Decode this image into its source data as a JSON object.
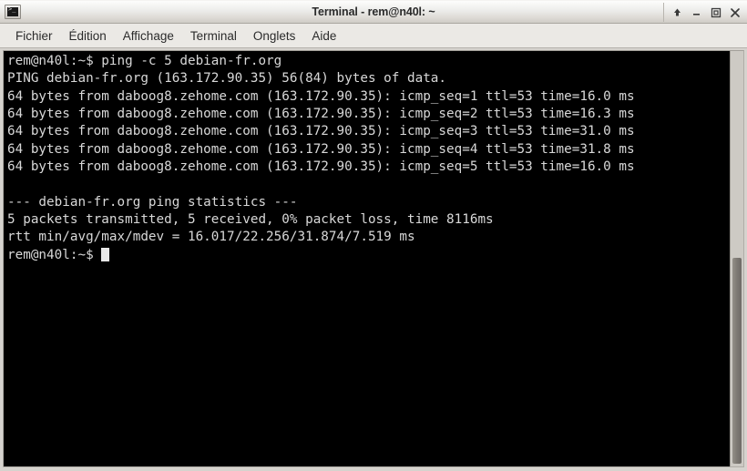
{
  "window": {
    "title": "Terminal - rem@n40l: ~",
    "icon": "terminal-icon",
    "controls": [
      {
        "name": "shade-button",
        "glyph": "↑"
      },
      {
        "name": "minimize-button",
        "glyph": "–"
      },
      {
        "name": "maximize-button",
        "glyph": "□"
      },
      {
        "name": "close-button",
        "glyph": "✕"
      }
    ]
  },
  "menubar": {
    "items": [
      {
        "label": "Fichier"
      },
      {
        "label": "Édition"
      },
      {
        "label": "Affichage"
      },
      {
        "label": "Terminal"
      },
      {
        "label": "Onglets"
      },
      {
        "label": "Aide"
      }
    ]
  },
  "terminal": {
    "background": "#000000",
    "foreground": "#d8d8d8",
    "prompt": "rem@n40l:~$ ",
    "command": "ping -c 5 debian-fr.org",
    "lines": [
      "rem@n40l:~$ ping -c 5 debian-fr.org",
      "PING debian-fr.org (163.172.90.35) 56(84) bytes of data.",
      "64 bytes from daboog8.zehome.com (163.172.90.35): icmp_seq=1 ttl=53 time=16.0 ms",
      "64 bytes from daboog8.zehome.com (163.172.90.35): icmp_seq=2 ttl=53 time=16.3 ms",
      "64 bytes from daboog8.zehome.com (163.172.90.35): icmp_seq=3 ttl=53 time=31.0 ms",
      "64 bytes from daboog8.zehome.com (163.172.90.35): icmp_seq=4 ttl=53 time=31.8 ms",
      "64 bytes from daboog8.zehome.com (163.172.90.35): icmp_seq=5 ttl=53 time=16.0 ms",
      "",
      "--- debian-fr.org ping statistics ---",
      "5 packets transmitted, 5 received, 0% packet loss, time 8116ms",
      "rtt min/avg/max/mdev = 16.017/22.256/31.874/7.519 ms"
    ],
    "final_prompt": "rem@n40l:~$ ",
    "cursor": "block"
  },
  "scrollbar": {
    "name": "vertical-scrollbar",
    "thumb_position": "bottom"
  }
}
